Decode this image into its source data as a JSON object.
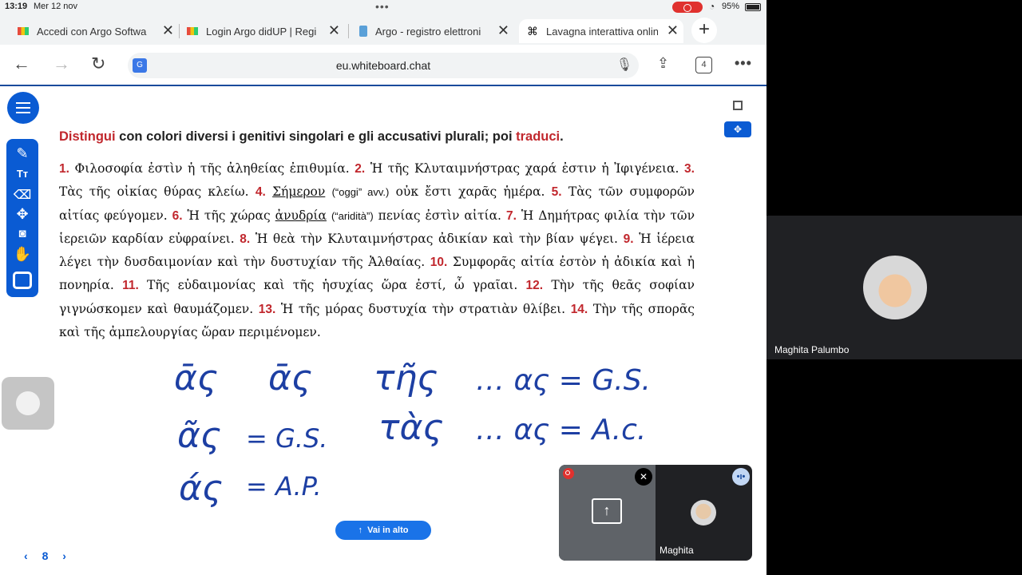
{
  "status_bar": {
    "time": "13:19",
    "date": "Mer 12 nov",
    "battery": "95%"
  },
  "tabs": [
    {
      "title": "Accedi con Argo Softwa",
      "favicon_color": "#e8b32a"
    },
    {
      "title": "Login Argo didUP | Regi",
      "favicon_color": "#e8b32a"
    },
    {
      "title": "Argo - registro elettroni",
      "favicon_color": "#5aa0d8"
    },
    {
      "title": "Lavagna interattiva onlin",
      "favicon_color": "#111111",
      "active": true
    }
  ],
  "tab_count": "4",
  "url": "eu.whiteboard.chat",
  "exercise": {
    "instruction_red1": "Distingui",
    "instruction_mid": " con colori diversi i genitivi singolari e gli accusativi plurali; poi ",
    "instruction_red2": "traduci",
    "instruction_end": ".",
    "items": [
      {
        "num": "1.",
        "text": "Φιλοσοφία ἐστὶν ἡ τῆς ἀληθείας ἐπιθυμία."
      },
      {
        "num": "2.",
        "text": "Ἡ τῆς Κλυταιμνήστρας χαρά ἐστιν ἡ Ἰφιγένεια."
      },
      {
        "num": "3.",
        "text": "Τὰς τῆς οἰκίας θύρας κλείω."
      },
      {
        "num": "4.",
        "text_ul": "Σήμερον",
        "note": "(“oggi” avv.)",
        "text": "οὐκ ἔστι χαρᾶς ἡμέρα."
      },
      {
        "num": "5.",
        "text": "Τὰς τῶν συμφορῶν αἰτίας φεύγομεν."
      },
      {
        "num": "6.",
        "text_pre": "Ἡ τῆς χώρας",
        "text_ul": "ἀνυδρία",
        "note": "(“aridità”)",
        "text": "πενίας ἐστὶν αἰτία."
      },
      {
        "num": "7.",
        "text": "Ἡ Δημήτρας φιλία τὴν τῶν ἱερειῶν καρδίαν εὐφραίνει."
      },
      {
        "num": "8.",
        "text": "Ἡ θεὰ τὴν Κλυταιμνήστρας ἀδικίαν καὶ τὴν βίαν ψέγει."
      },
      {
        "num": "9.",
        "text": "Ἡ ἱέρεια λέγει τὴν δυσδαιμονίαν καὶ τὴν δυστυχίαν τῆς Ἀλθαίας."
      },
      {
        "num": "10.",
        "text": "Συμφορᾶς αἰτία ἐστὸν ἡ ἀδικία καὶ ἡ πονηρία."
      },
      {
        "num": "11.",
        "text": "Τῆς εὐδαιμονίας καὶ τῆς ἡσυχίας ὥρα ἐστί, ὦ γραῖαι."
      },
      {
        "num": "12.",
        "text": "Τὴν τῆς θεᾶς σοφίαν γιγνώσκομεν καὶ θαυμάζομεν."
      },
      {
        "num": "13.",
        "text": "Ἡ τῆς μόρας δυστυχία τὴν στρατιὰν θλίβει."
      },
      {
        "num": "14.",
        "text": "Τὴν τῆς σπορᾶς καὶ τῆς ἀμπελουργίας ὥραν περιμένομεν."
      }
    ]
  },
  "handwriting": {
    "l1a": "ᾱς",
    "l1b": "ᾱς",
    "l1c": "τῆς",
    "l1d": "… ας = G.S.",
    "l2a": "ᾶς",
    "l2b": "= G.S.",
    "l2c": "τὰς",
    "l2d": "… ας = A.c.",
    "l3a": "άς",
    "l3b": "= A.P."
  },
  "scroll_top_label": "Vai in alto",
  "page_number": "8",
  "call": {
    "participant_name_short": "Maghita"
  },
  "participant_name": "Maghita Palumbo",
  "colors": {
    "brand_blue": "#0a5bd3",
    "accent_red": "#c1272d",
    "ink_blue": "#1d3fa3"
  }
}
